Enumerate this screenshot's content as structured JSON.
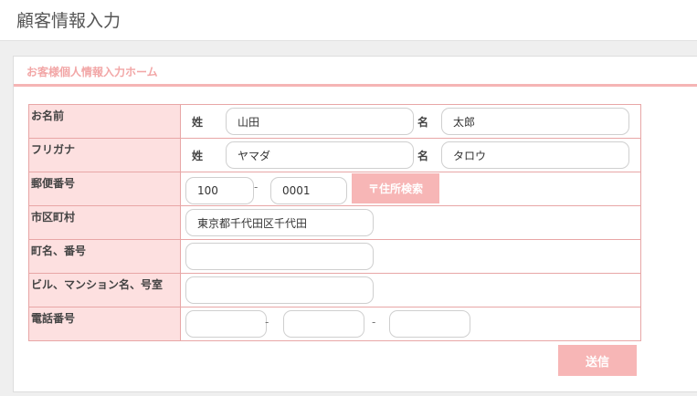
{
  "page": {
    "title": "顧客情報入力"
  },
  "panel": {
    "heading": "お客様個人情報入力ホーム"
  },
  "form": {
    "name": {
      "label": "お名前",
      "last_label": "姓",
      "last_value": "山田",
      "first_label": "名",
      "first_value": "太郎"
    },
    "furigana": {
      "label": "フリガナ",
      "last_label": "姓",
      "last_value": "ヤマダ",
      "first_label": "名",
      "first_value": "タロウ"
    },
    "postal": {
      "label": "郵便番号",
      "part1": "100",
      "separator": "-",
      "part2": "0001",
      "search_button": "〒住所検索"
    },
    "city": {
      "label": "市区町村",
      "value": "東京都千代田区千代田"
    },
    "town": {
      "label": "町名、番号",
      "value": ""
    },
    "building": {
      "label": "ビル、マンション名、号室",
      "value": ""
    },
    "phone": {
      "label": "電話番号",
      "part1": "",
      "part2": "",
      "part3": "",
      "separator": "-"
    },
    "submit": "送信"
  }
}
